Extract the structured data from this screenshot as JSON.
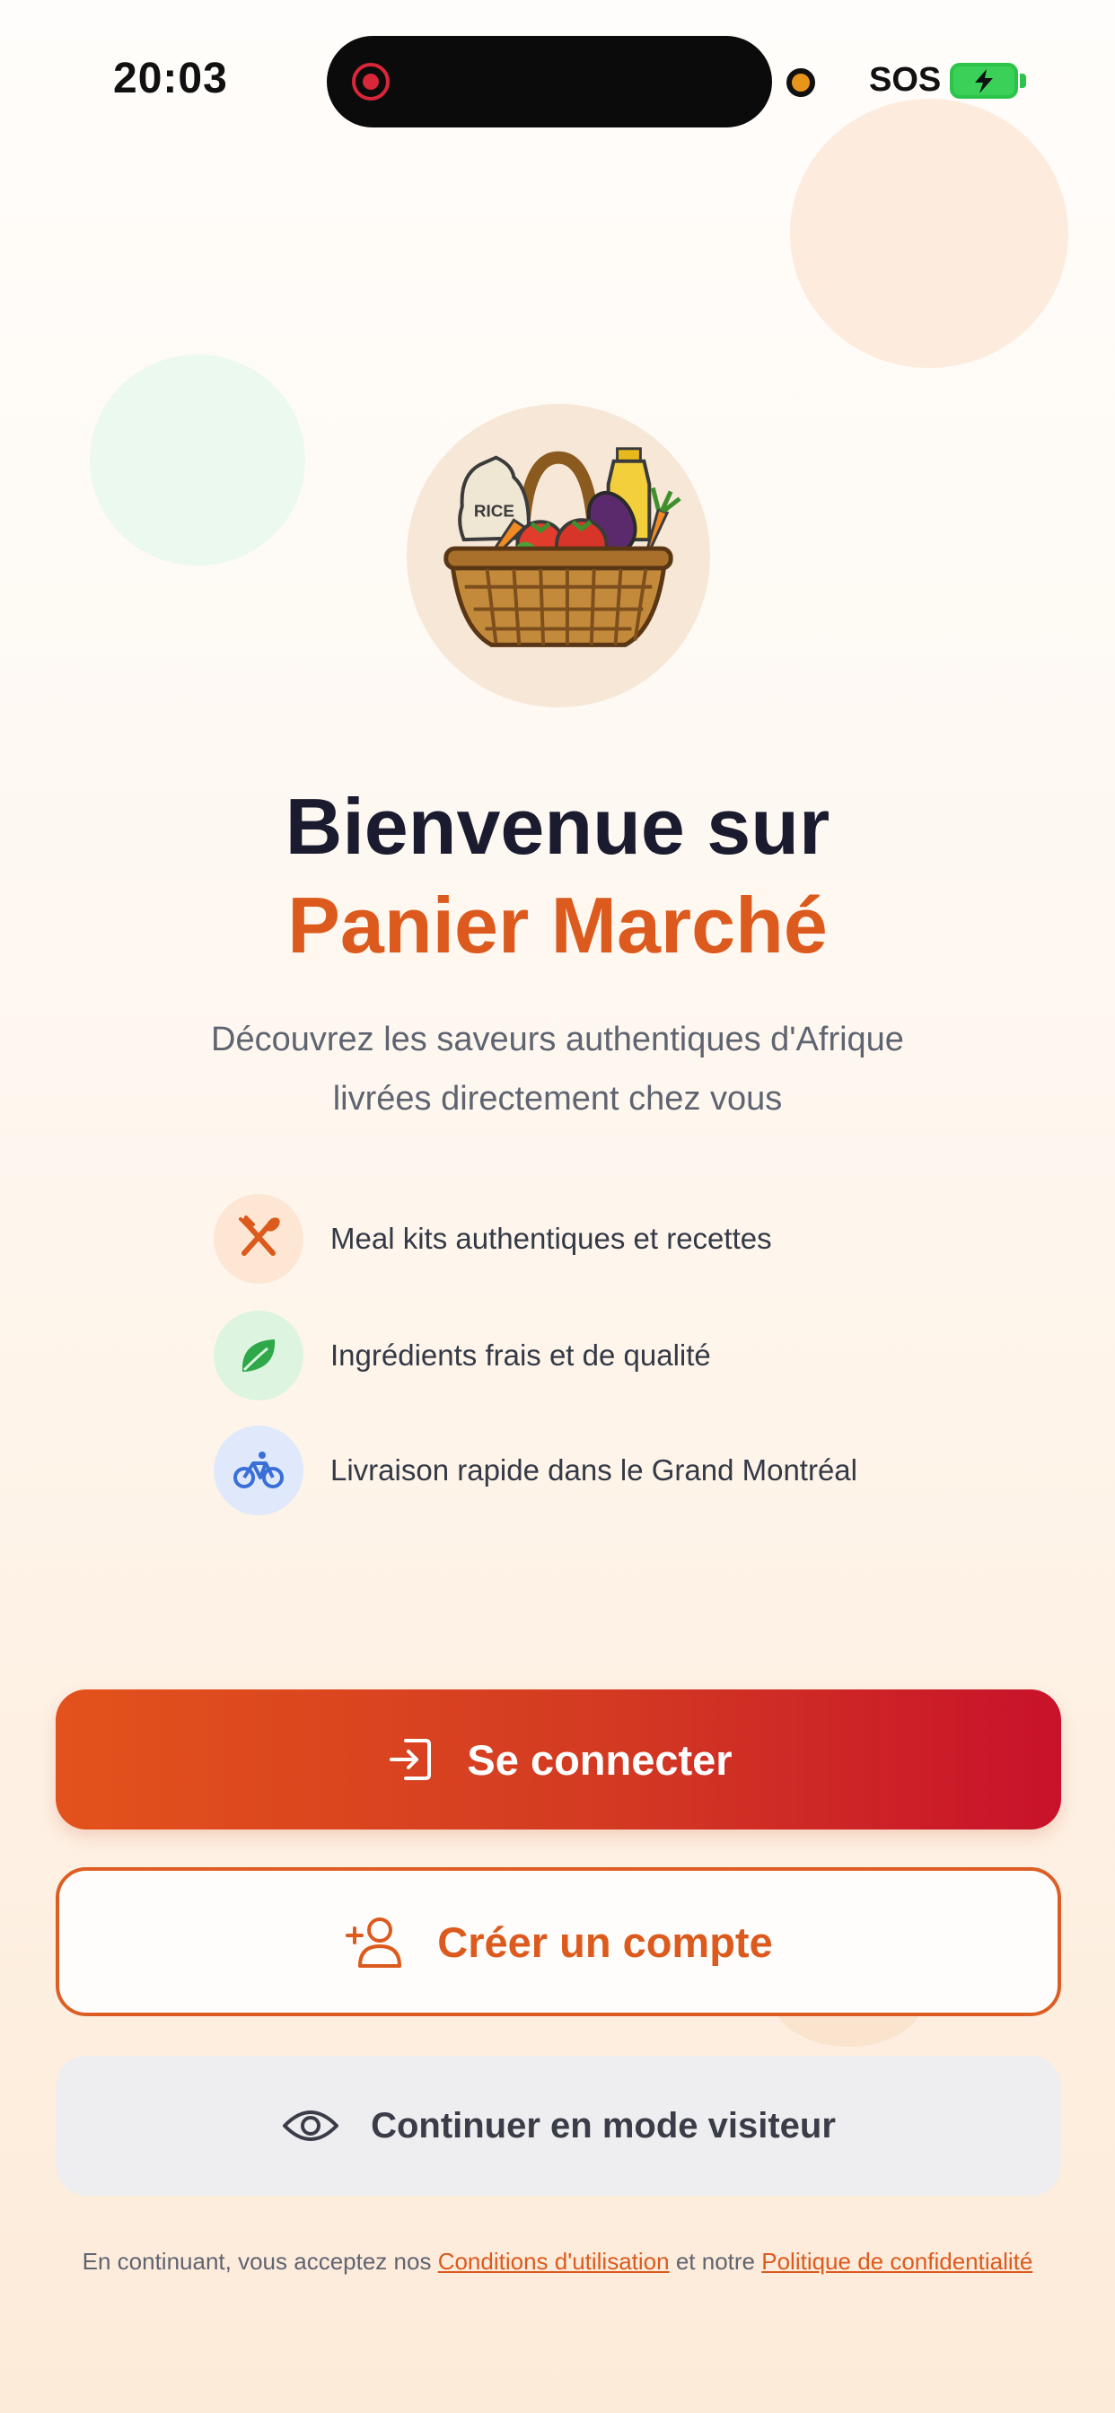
{
  "status_bar": {
    "time": "20:03",
    "sos": "SOS",
    "colors": {
      "recording": "#d8263a",
      "battery": "#3bd158",
      "indicator": "#e9951c"
    }
  },
  "logo": {
    "icon": "basket-icon",
    "bag_label": "RICE"
  },
  "welcome": {
    "title_line1": "Bienvenue sur",
    "title_line2": "Panier Marché",
    "subtitle_line1": "Découvrez les saveurs authentiques d'Afrique",
    "subtitle_line2": "livrées directement chez vous"
  },
  "features": [
    {
      "icon": "utensils-icon",
      "label": "Meal kits authentiques et recettes",
      "color": "#dc5a1d"
    },
    {
      "icon": "leaf-icon",
      "label": "Ingrédients frais et de qualité",
      "color": "#2fa84a"
    },
    {
      "icon": "bicycle-icon",
      "label": "Livraison rapide dans le Grand Montréal",
      "color": "#3a6fd8"
    }
  ],
  "buttons": {
    "login": {
      "label": "Se connecter",
      "icon": "login-icon"
    },
    "register": {
      "label": "Créer un compte",
      "icon": "user-plus-icon"
    },
    "guest": {
      "label": "Continuer en mode visiteur",
      "icon": "eye-icon"
    }
  },
  "footer": {
    "prefix": "En continuant, vous acceptez nos",
    "terms_link": "Conditions d'utilisation",
    "middle": "et notre",
    "privacy_link": "Politique de confidentialité"
  },
  "colors": {
    "accent": "#dc5a1d",
    "primary_gradient_start": "#e3521c",
    "primary_gradient_end": "#c8122b",
    "title_dark": "#1a1b2e"
  }
}
